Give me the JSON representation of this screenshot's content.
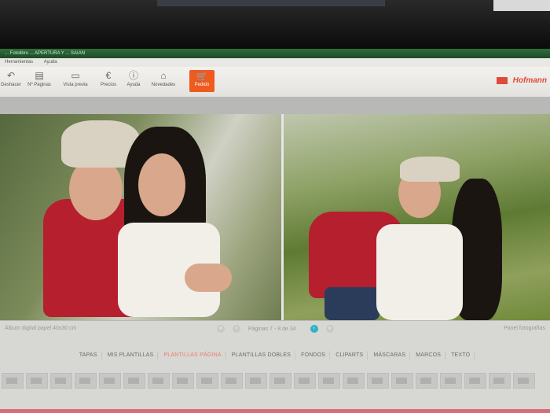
{
  "window": {
    "title": "... Fotolibro ... APERTURA Y ... SAIAN"
  },
  "menu": {
    "items": [
      "Herramientas",
      "Ayuda"
    ]
  },
  "toolbar": {
    "items": [
      {
        "label": "Deshacer",
        "icon": "undo-icon"
      },
      {
        "label": "Nº Páginas",
        "icon": "pages-icon"
      },
      {
        "label": "Vista previa",
        "icon": "preview-icon"
      },
      {
        "label": "Precios",
        "icon": "euro-icon"
      },
      {
        "label": "Ayuda",
        "icon": "info-icon"
      },
      {
        "label": "Novedades",
        "icon": "home-icon"
      }
    ],
    "order_label": "Pedido",
    "brand": "Hofmann",
    "accent": "#ef5a1e"
  },
  "canvas": {
    "photos": [
      {
        "name": "couple-hug-photo",
        "icon": "photo-left"
      },
      {
        "name": "couple-kiss-photo",
        "icon": "photo-right"
      }
    ]
  },
  "status": {
    "left": "Álbum digital papel 40x30 cm",
    "right": "Panel fotografías",
    "pager_text": "Páginas 7 - 8 de 34"
  },
  "tabs": [
    {
      "label": "TAPAS"
    },
    {
      "label": "MIS PLANTILLAS"
    },
    {
      "label": "PLANTILLAS PÁGINA",
      "active": true
    },
    {
      "label": "PLANTILLAS DOBLES"
    },
    {
      "label": "FONDOS"
    },
    {
      "label": "CLIPARTS"
    },
    {
      "label": "MÁSCARAS"
    },
    {
      "label": "MARCOS"
    },
    {
      "label": "TEXTO"
    }
  ],
  "colors": {
    "active_tab": "#f07a6a",
    "pager_active": "#2bb3c6"
  }
}
